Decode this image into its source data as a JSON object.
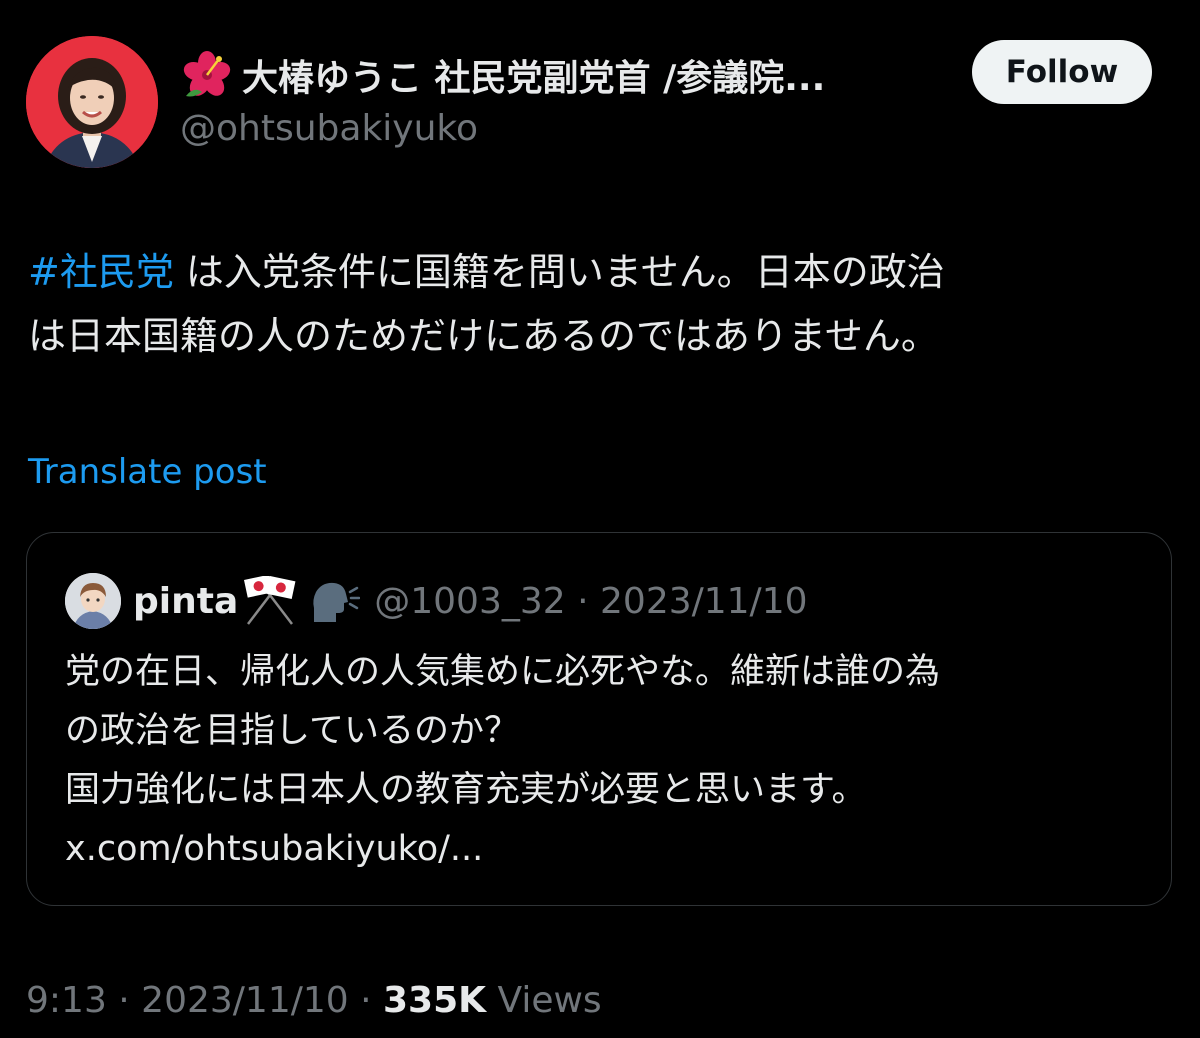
{
  "author": {
    "display_name": "大椿ゆうこ 社民党副党首 /参議院...",
    "handle": "@ohtsubakiyuko",
    "name_emoji_icon": "hibiscus-icon",
    "avatar_bg": "#e8313f"
  },
  "follow_button": {
    "label": "Follow"
  },
  "post": {
    "hashtag": "#社民党",
    "text_line1": " は入党条件に国籍を問いません。日本の政治",
    "text_line2": "は日本国籍の人のためだけにあるのではありません。",
    "translate_label": "Translate post"
  },
  "quote": {
    "name": "pinta",
    "name_icons": [
      "crossed-flags-icon",
      "speaking-head-icon"
    ],
    "meta": "@1003_32 · 2023/11/10",
    "lines": [
      "党の在日、帰化人の人気集めに必死やな。維新は誰の為",
      "の政治を目指しているのか？",
      "国力強化には日本人の教育充実が必要と思います。",
      "x.com/ohtsubakiyuko/..."
    ]
  },
  "footer": {
    "time_date": "9:13 · 2023/11/10 · ",
    "views_count": "335K",
    "views_label": " Views"
  },
  "colors": {
    "background": "#000000",
    "text": "#e7e9ea",
    "muted": "#71767b",
    "accent": "#1d9bf0",
    "border": "#2f3336"
  }
}
